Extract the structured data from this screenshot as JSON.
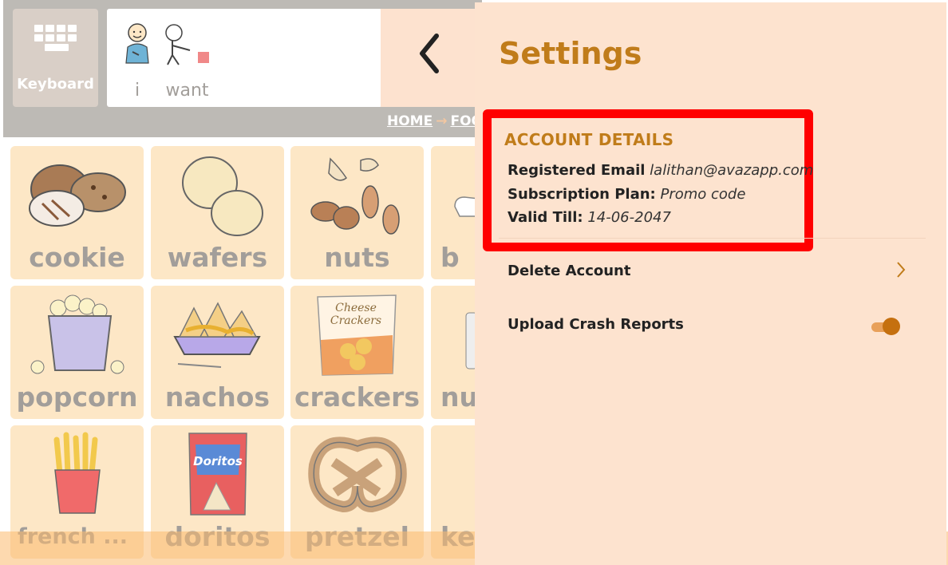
{
  "topbar": {
    "keyboard_label": "Keyboard",
    "sentence": [
      {
        "word": "i",
        "icon": "person-pointing-self-icon"
      },
      {
        "word": "want",
        "icon": "person-reaching-icon"
      }
    ],
    "back_icon": "chevron-left-icon",
    "breadcrumb": {
      "home": "HOME",
      "current": "FOO"
    }
  },
  "grid": {
    "tiles": [
      {
        "label": "cookie",
        "icon": "cookie-icon"
      },
      {
        "label": "wafers",
        "icon": "wafers-icon"
      },
      {
        "label": "nuts",
        "icon": "nuts-icon"
      },
      {
        "label": "b",
        "icon": "partial-icon"
      },
      {
        "label": "popcorn",
        "icon": "popcorn-icon"
      },
      {
        "label": "nachos",
        "icon": "nachos-icon"
      },
      {
        "label": "crackers",
        "icon": "crackers-icon",
        "pack_text": "Cheese Crackers"
      },
      {
        "label": "nu",
        "icon": "partial-icon"
      },
      {
        "label": "french ...",
        "icon": "french-fries-icon"
      },
      {
        "label": "doritos",
        "icon": "doritos-icon",
        "pack_text": "Doritos"
      },
      {
        "label": "pretzel",
        "icon": "pretzel-icon"
      },
      {
        "label": "ke",
        "icon": "partial-icon"
      }
    ]
  },
  "settings": {
    "title": "Settings",
    "account": {
      "heading": "ACCOUNT DETAILS",
      "email_label": "Registered Email",
      "email_value": "lalithan@avazapp.com",
      "plan_label": "Subscription Plan:",
      "plan_value": "Promo code",
      "valid_label": "Valid Till:",
      "valid_value": "14-06-2047"
    },
    "delete_account": "Delete Account",
    "upload_crash_reports": "Upload Crash Reports",
    "upload_crash_reports_enabled": true
  },
  "colors": {
    "accent": "#c07c1a",
    "highlight": "#ff0000",
    "panel_bg": "#fde3cf",
    "tile_bg": "#fde7c6"
  }
}
